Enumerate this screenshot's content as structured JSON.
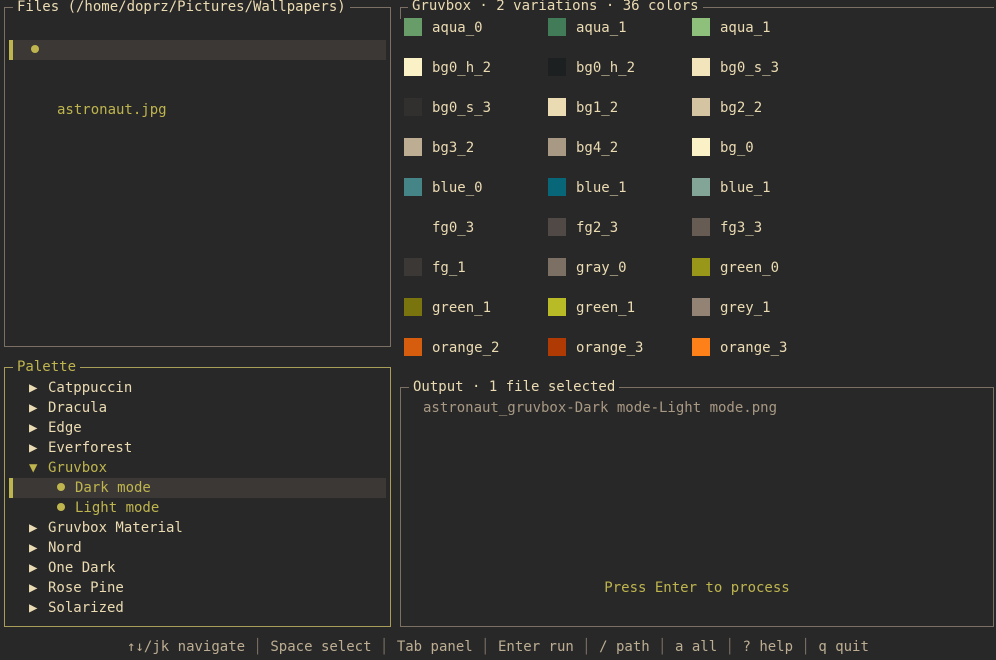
{
  "files": {
    "title": "Files (/home/doprz/Pictures/Wallpapers)",
    "parent": "..",
    "items": [
      {
        "name": "astronaut.jpg",
        "selected": true
      }
    ]
  },
  "colors": {
    "title": "Gruvbox · 2 variations · 36 colors",
    "swatches": [
      {
        "name": "aqua_0",
        "color": "#689d6a"
      },
      {
        "name": "aqua_1",
        "color": "#427b58"
      },
      {
        "name": "aqua_1",
        "color": "#8ec07c"
      },
      {
        "name": "bg0_h_2",
        "color": "#fbf1c7"
      },
      {
        "name": "bg0_h_2",
        "color": "#1d2021"
      },
      {
        "name": "bg0_s_3",
        "color": "#f2e5bc"
      },
      {
        "name": "bg0_s_3",
        "color": "#32302f"
      },
      {
        "name": "bg1_2",
        "color": "#ebdbb2"
      },
      {
        "name": "bg2_2",
        "color": "#d5c4a1"
      },
      {
        "name": "bg3_2",
        "color": "#bdae93"
      },
      {
        "name": "bg4_2",
        "color": "#a89984"
      },
      {
        "name": "bg_0",
        "color": "#fbf1c7"
      },
      {
        "name": "blue_0",
        "color": "#458588"
      },
      {
        "name": "blue_1",
        "color": "#076678"
      },
      {
        "name": "blue_1",
        "color": "#83a598"
      },
      {
        "name": "fg0_3",
        "color": "#282828"
      },
      {
        "name": "fg2_3",
        "color": "#504945"
      },
      {
        "name": "fg3_3",
        "color": "#665c54"
      },
      {
        "name": "fg_1",
        "color": "#3c3836"
      },
      {
        "name": "gray_0",
        "color": "#7c6f64"
      },
      {
        "name": "green_0",
        "color": "#98971a"
      },
      {
        "name": "green_1",
        "color": "#79740e"
      },
      {
        "name": "green_1",
        "color": "#b8bb26"
      },
      {
        "name": "grey_1",
        "color": "#928374"
      },
      {
        "name": "orange_2",
        "color": "#d65d0e"
      },
      {
        "name": "orange_3",
        "color": "#af3a03"
      },
      {
        "name": "orange_3",
        "color": "#fe8019"
      }
    ]
  },
  "palette": {
    "title": "Palette",
    "items": [
      {
        "label": "Catppuccin",
        "expanded": false
      },
      {
        "label": "Dracula",
        "expanded": false
      },
      {
        "label": "Edge",
        "expanded": false
      },
      {
        "label": "Everforest",
        "expanded": false
      },
      {
        "label": "Gruvbox",
        "expanded": true,
        "children": [
          {
            "label": "Dark mode",
            "selected": true
          },
          {
            "label": "Light mode",
            "selected": false
          }
        ]
      },
      {
        "label": "Gruvbox Material",
        "expanded": false
      },
      {
        "label": "Nord",
        "expanded": false
      },
      {
        "label": "One Dark",
        "expanded": false
      },
      {
        "label": "Rose Pine",
        "expanded": false
      },
      {
        "label": "Solarized",
        "expanded": false
      }
    ]
  },
  "output": {
    "title": "Output · 1 file selected",
    "files": [
      "astronaut_gruvbox-Dark mode-Light mode.png"
    ],
    "prompt": "Press Enter to process"
  },
  "footer": {
    "hints": [
      "↑↓/jk navigate",
      "Space select",
      "Tab panel",
      "Enter run",
      "/ path",
      "a all",
      "? help",
      "q quit"
    ]
  },
  "theme": {
    "accent": "#bfb54e",
    "background": "#282828",
    "foreground": "#ebdbb2",
    "selection": "#3c3836",
    "border": "#7c6f64",
    "muted": "#bdae93"
  }
}
